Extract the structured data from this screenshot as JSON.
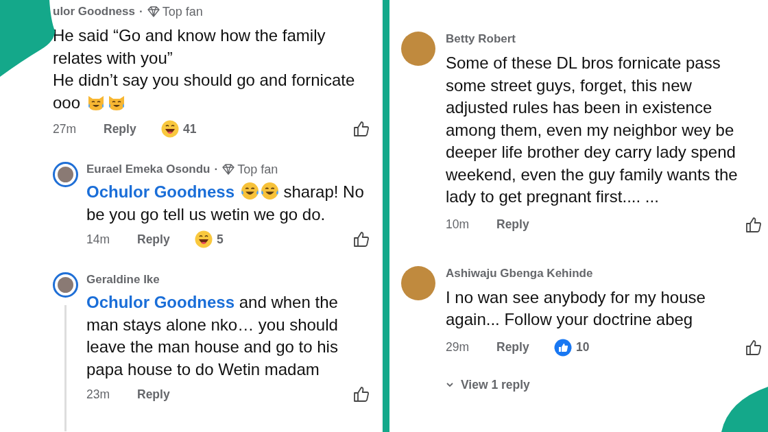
{
  "panels": [
    {
      "comments": [
        {
          "author": "ulor Goodness",
          "separator": "·",
          "badge": "Top fan",
          "text": "He said “Go and know how the family relates with you”\nHe didn’t say you should go and fornicate ooo",
          "emojis": [
            {
              "kind": "cat"
            },
            {
              "kind": "cat"
            }
          ],
          "time": "27m",
          "reply_label": "Reply",
          "reaction": {
            "kind": "haha",
            "count": "41"
          },
          "replies": [
            {
              "author": "Eurael Emeka Osondu",
              "separator": "·",
              "badge": "Top fan",
              "avatar": {
                "ring": true
              },
              "mention": "Ochulor Goodness",
              "emojis_after_mention": [
                {
                  "kind": "tears"
                },
                {
                  "kind": "tears"
                }
              ],
              "text": "sharap! No be you go tell us wetin we go do.",
              "time": "14m",
              "reply_label": "Reply",
              "reaction": {
                "kind": "haha",
                "count": "5"
              }
            },
            {
              "author": "Geraldine Ike",
              "avatar": {
                "ring": true
              },
              "thread_line": true,
              "mention": "Ochulor Goodness",
              "text": "and when the man stays alone nko… you should leave the man house and go to his papa house to do Wetin madam",
              "time": "23m",
              "reply_label": "Reply"
            }
          ]
        }
      ]
    },
    {
      "comments": [
        {
          "author": "Betty Robert",
          "avatar": {
            "ring": false
          },
          "text": "Some of these DL bros fornicate pass some street guys, forget, this new adjusted rules has been in existence among them, even my neighbor wey be deeper life brother dey carry lady spend weekend, even the guy family wants the lady to get pregnant first.... ...",
          "time": "10m",
          "reply_label": "Reply"
        },
        {
          "author": "Ashiwaju Gbenga Kehinde",
          "avatar": {
            "ring": false
          },
          "text": "I no wan see anybody for my house again... Follow your doctrine abeg",
          "time": "29m",
          "reply_label": "Reply",
          "reaction": {
            "kind": "like",
            "count": "10"
          },
          "view_replies": "View 1 reply"
        }
      ]
    }
  ]
}
